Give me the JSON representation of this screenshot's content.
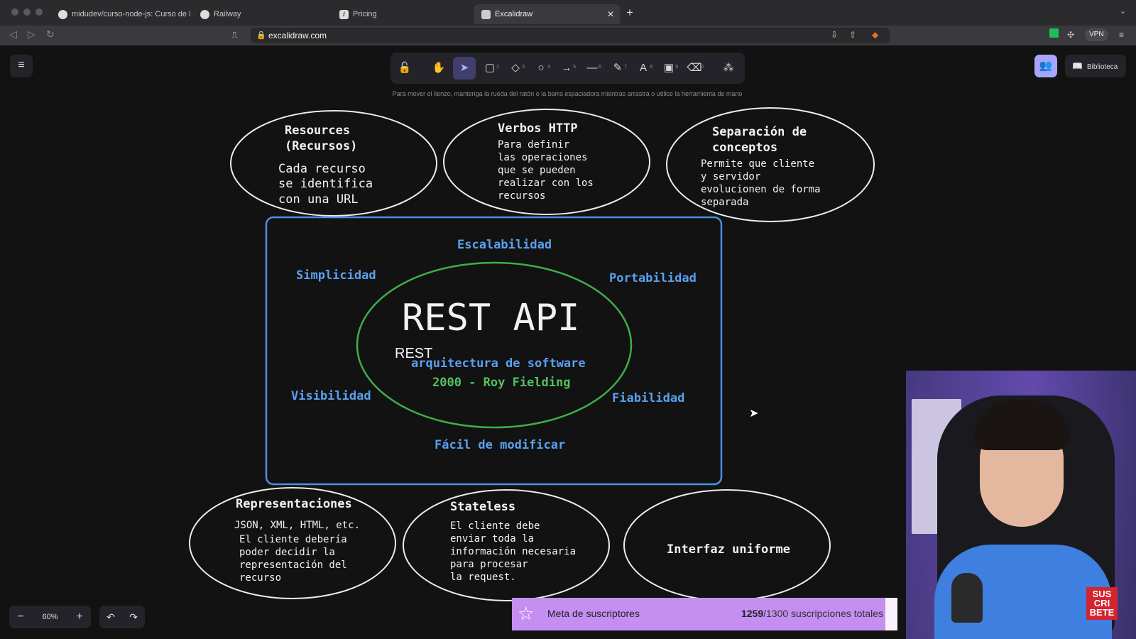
{
  "browser": {
    "tabs": [
      {
        "title": "midudev/curso-node-js: Curso de N"
      },
      {
        "title": "Railway"
      },
      {
        "title": "Pricing"
      },
      {
        "title": "Excalidraw"
      }
    ],
    "url": "excalidraw.com",
    "vpn_label": "VPN"
  },
  "excalidraw": {
    "hint": "Para mover el lienzo, mantenga la rueda del ratón o la barra espaciadora mientras arrastra o utilice la herramienta de mano",
    "tool_numbers": [
      "2",
      "3",
      "4",
      "5",
      "6",
      "7",
      "8",
      "9",
      "0"
    ],
    "library_label": "Biblioteca",
    "zoom": "60%"
  },
  "canvas": {
    "resources": {
      "title": "Resources\n(Recursos)",
      "title1": "Resources",
      "title2": "(Recursos)",
      "body": [
        "Cada recurso",
        "se identifica",
        "con una URL"
      ]
    },
    "verbos": {
      "title": "Verbos HTTP",
      "body": [
        "Para definir",
        "las operaciones",
        "que se pueden",
        "realizar con los",
        "recursos"
      ]
    },
    "separacion": {
      "title1": "Separación de",
      "title2": "conceptos",
      "body": [
        "Permite que cliente",
        "y servidor",
        "evolucionen de forma",
        "separada"
      ]
    },
    "center": {
      "title": "REST API",
      "rest_label": "REST",
      "subtitle": "arquitectura de software",
      "origin": "2000 - Roy Fielding"
    },
    "properties": {
      "escalabilidad": "Escalabilidad",
      "simplicidad": "Simplicidad",
      "portabilidad": "Portabilidad",
      "visibilidad": "Visibilidad",
      "fiabilidad": "Fiabilidad",
      "facil": "Fácil de modificar"
    },
    "representaciones": {
      "title": "Representaciones",
      "body": [
        "JSON, XML, HTML, etc.",
        "El cliente debería",
        "poder decidir la",
        "representación del",
        "recurso"
      ]
    },
    "stateless": {
      "title": "Stateless",
      "body": [
        "El cliente debe",
        "enviar toda la",
        "información necesaria",
        "para procesar",
        "la request."
      ]
    },
    "interfaz": {
      "title": "Interfaz uniforme"
    }
  },
  "overlay": {
    "goal_label": "Meta de suscriptores",
    "goal_current": "1259",
    "goal_rest": "/1300 suscripciones totales",
    "goal_progress": 0.968,
    "subscribe_badge": "SUS\nCRI\nBETE"
  }
}
